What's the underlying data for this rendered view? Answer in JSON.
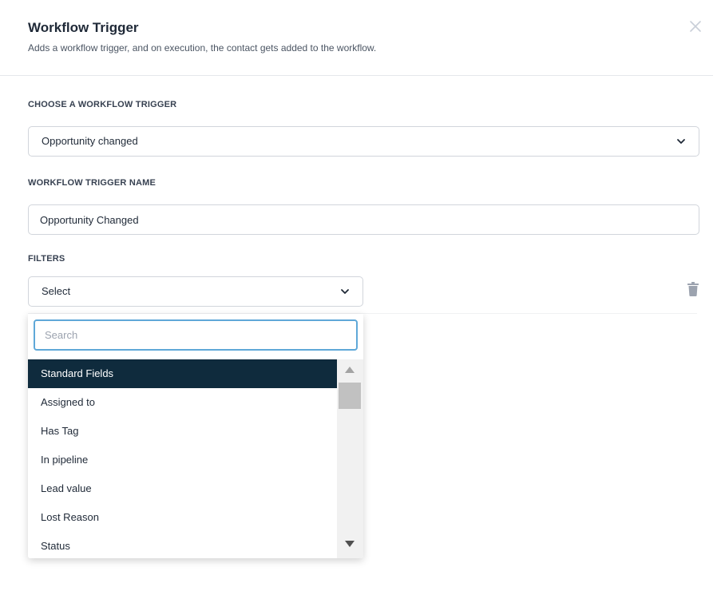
{
  "header": {
    "title": "Workflow Trigger",
    "subtitle": "Adds a workflow trigger, and on execution, the contact gets added to the workflow."
  },
  "trigger": {
    "label": "CHOOSE A WORKFLOW TRIGGER",
    "selected": "Opportunity changed"
  },
  "trigger_name": {
    "label": "WORKFLOW TRIGGER NAME",
    "value": "Opportunity Changed"
  },
  "filters": {
    "label": "FILTERS",
    "selected": "Select",
    "dropdown": {
      "search_placeholder": "Search",
      "group_label": "Standard Fields",
      "options": [
        "Assigned to",
        "Has Tag",
        "In pipeline",
        "Lead value",
        "Lost Reason",
        "Status"
      ]
    }
  },
  "icons": {
    "close": "close-icon",
    "chevron": "chevron-down-icon",
    "trash": "trash-icon",
    "scroll_up": "triangle-up-icon",
    "scroll_down": "triangle-down-icon"
  },
  "colors": {
    "group_highlight": "#0f2b3d",
    "focus_border": "#5fa8d8"
  }
}
